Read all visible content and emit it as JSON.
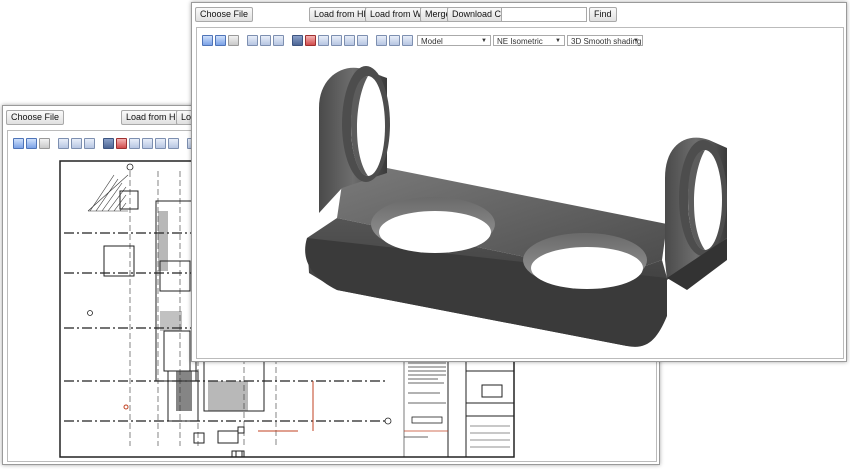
{
  "back_window": {
    "toolbar": {
      "choose_file": "Choose File",
      "load_hdd": "Load from HDD",
      "load_web_partial": "Loa"
    }
  },
  "front_window": {
    "toolbar": {
      "choose_file": "Choose File",
      "load_hdd": "Load from HDD",
      "load_web": "Load from Web",
      "merge": "Merge",
      "download_csv": "Download CSV",
      "search_value": "",
      "find": "Find"
    },
    "view_toolbar": {
      "model_select": "Model",
      "view_select": "NE Isometric",
      "shading_select": "3D Smooth shading"
    }
  },
  "colors": {
    "toolbar_icon": "#b7c6e2",
    "window_border": "#9a9a9a",
    "model_dark": "#3a3a3a",
    "model_mid": "#5a5a5a",
    "model_light": "#8a8a8a",
    "drawing_red": "#c04020"
  }
}
